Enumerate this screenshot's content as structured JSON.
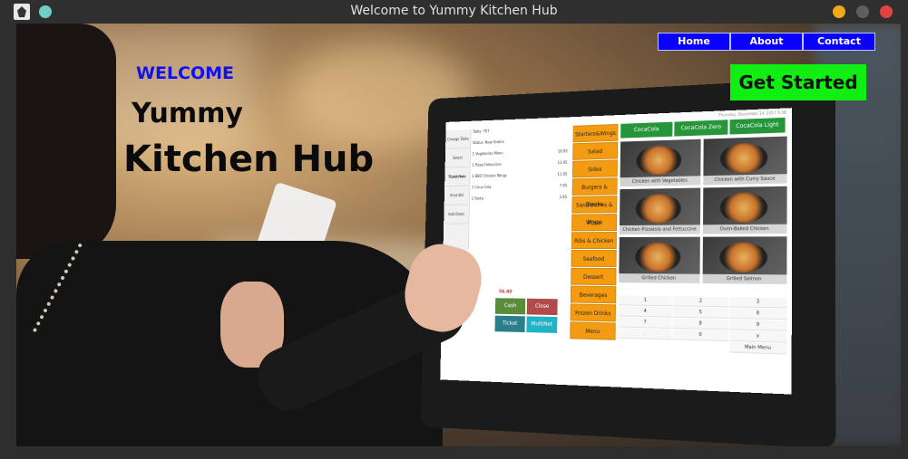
{
  "window": {
    "title": "Welcome to Yummy Kitchen Hub"
  },
  "hero": {
    "welcome": "WELCOME",
    "line1": "Yummy",
    "line2": "Kitchen Hub"
  },
  "nav": {
    "items": [
      "Home",
      "About",
      "Contact"
    ]
  },
  "cta": {
    "label": "Get Started"
  },
  "colors": {
    "nav_bg": "#0a00ff",
    "cta_bg": "#11ee11",
    "welcome_text": "#1111ee"
  },
  "pos_screen": {
    "date": "Thursday, December 14, 2017 5:38",
    "side_buttons": [
      "Change Table",
      "Select Customer",
      "Ticket Note",
      "Print Bill",
      "Add Order"
    ],
    "order_header": [
      "Table: T07",
      "Status: New Orders"
    ],
    "order_lines": [
      {
        "qty": "1",
        "name": "Vegetarian Menu",
        "price": "16.95"
      },
      {
        "qty": "1",
        "name": "Pizza Fettuccine",
        "price": "12.95"
      },
      {
        "qty": "1",
        "name": "BBQ Chicken Wings",
        "price": "11.95"
      },
      {
        "qty": "1",
        "name": "Coca-Cola",
        "price": "7.95"
      },
      {
        "qty": "1",
        "name": "Fanta",
        "price": "3.95"
      }
    ],
    "total": "56.40",
    "payment_buttons": [
      "Cash",
      "Close",
      "Ticket",
      "MultiNet"
    ],
    "categories": [
      "Starters&Wings",
      "Salad",
      "Sides",
      "Burgers & Steaks",
      "Sandwiches & Wraps",
      "Pizza",
      "Ribs & Chicken",
      "Seafood",
      "Dessert",
      "Beverages",
      "Frozen Drinks",
      "Menu"
    ],
    "drinks": [
      "CocaCola",
      "CocaCola Zero",
      "CocaCola Light"
    ],
    "food_items": [
      "Chicken with Vegetables",
      "Chicken with Curry Sauce",
      "Chicken Pizzaiola and Fettuccine",
      "Oven-Baked Chicken",
      "Grilled Chicken",
      "Grilled Salmon"
    ],
    "keypad": [
      "1",
      "2",
      "3",
      "4",
      "5",
      "6",
      "7",
      "8",
      "9",
      ".",
      "0",
      "x"
    ],
    "main_menu": "Main Menu"
  }
}
